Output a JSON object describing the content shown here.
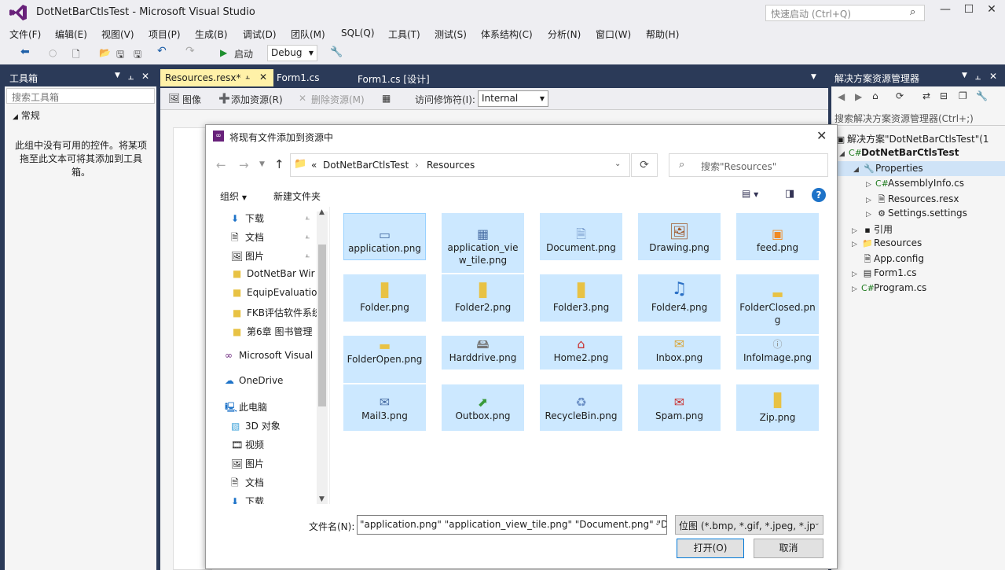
{
  "window": {
    "title": "DotNetBarCtlsTest - Microsoft Visual Studio",
    "quick_launch_placeholder": "快速启动 (Ctrl+Q)"
  },
  "menu": [
    "文件(F)",
    "编辑(E)",
    "视图(V)",
    "项目(P)",
    "生成(B)",
    "调试(D)",
    "团队(M)",
    "SQL(Q)",
    "工具(T)",
    "测试(S)",
    "体系结构(C)",
    "分析(N)",
    "窗口(W)",
    "帮助(H)"
  ],
  "toolbar": {
    "start_label": "启动",
    "config": "Debug"
  },
  "toolbox": {
    "title": "工具箱",
    "search_placeholder": "搜索工具箱",
    "group": "常规",
    "empty_text": "此组中没有可用的控件。将某项拖至此文本可将其添加到工具箱。"
  },
  "editor": {
    "tabs": [
      {
        "label": "Resources.resx*"
      },
      {
        "label": "Form1.cs"
      },
      {
        "label": "Form1.cs [设计]"
      }
    ],
    "tools": {
      "image": "图像",
      "add_resource": "添加资源(R)",
      "remove_resource": "删除资源(M)",
      "access_label": "访问修饰符(I):",
      "access_value": "Internal"
    }
  },
  "solution_explorer": {
    "title": "解决方案资源管理器",
    "search_placeholder": "搜索解决方案资源管理器(Ctrl+;)",
    "items": [
      {
        "label": "解决方案\"DotNetBarCtlsTest\"(1",
        "icon": "solution-icon"
      },
      {
        "label": "DotNetBarCtlsTest",
        "icon": "csharp-project-icon"
      },
      {
        "label": "Properties",
        "icon": "wrench-icon"
      },
      {
        "label": "AssemblyInfo.cs",
        "icon": "csharp-file-icon"
      },
      {
        "label": "Resources.resx",
        "icon": "resx-icon"
      },
      {
        "label": "Settings.settings",
        "icon": "gear-icon"
      },
      {
        "label": "引用",
        "icon": "references-icon"
      },
      {
        "label": "Resources",
        "icon": "folder-icon"
      },
      {
        "label": "App.config",
        "icon": "config-icon"
      },
      {
        "label": "Form1.cs",
        "icon": "form-icon"
      },
      {
        "label": "Program.cs",
        "icon": "csharp-file-icon"
      }
    ]
  },
  "dialog": {
    "title": "将现有文件添加到资源中",
    "breadcrumb": [
      "«",
      "DotNetBarCtlsTest",
      "Resources"
    ],
    "search_placeholder": "搜索\"Resources\"",
    "organize": "组织",
    "new_folder": "新建文件夹",
    "nav": [
      {
        "label": "下载",
        "icon": "download-icon",
        "pinned": true
      },
      {
        "label": "文档",
        "icon": "document-icon",
        "pinned": true
      },
      {
        "label": "图片",
        "icon": "pictures-icon",
        "pinned": true
      },
      {
        "label": "DotNetBar Wir",
        "icon": "folder-icon",
        "pinned": false
      },
      {
        "label": "EquipEvaluatio",
        "icon": "folder-icon",
        "pinned": false
      },
      {
        "label": "FKB评估软件系统",
        "icon": "folder-icon",
        "pinned": false
      },
      {
        "label": "第6章 图书管理",
        "icon": "folder-icon",
        "pinned": false
      },
      {
        "label": "Microsoft Visual",
        "icon": "vs-icon",
        "pinned": false
      },
      {
        "label": "OneDrive",
        "icon": "cloud-icon",
        "pinned": false
      },
      {
        "label": "此电脑",
        "icon": "computer-icon",
        "pinned": false
      },
      {
        "label": "3D 对象",
        "icon": "cube-icon",
        "pinned": false
      },
      {
        "label": "视频",
        "icon": "video-icon",
        "pinned": false
      },
      {
        "label": "图片",
        "icon": "pictures-icon",
        "pinned": false
      },
      {
        "label": "文档",
        "icon": "document-icon",
        "pinned": false
      },
      {
        "label": "下载",
        "icon": "download-icon",
        "pinned": false
      }
    ],
    "files": [
      {
        "name": "application.png",
        "icon": "window-icon"
      },
      {
        "name": "application_view_tile.png",
        "icon": "tile-icon"
      },
      {
        "name": "Document.png",
        "icon": "document-icon"
      },
      {
        "name": "Drawing.png",
        "icon": "drawing-icon"
      },
      {
        "name": "feed.png",
        "icon": "rss-icon"
      },
      {
        "name": "Folder.png",
        "icon": "folder-icon"
      },
      {
        "name": "Folder2.png",
        "icon": "folder-icon"
      },
      {
        "name": "Folder3.png",
        "icon": "folder-icon"
      },
      {
        "name": "Folder4.png",
        "icon": "music-folder-icon"
      },
      {
        "name": "FolderClosed.png",
        "icon": "folder-icon"
      },
      {
        "name": "FolderOpen.png",
        "icon": "folder-open-icon"
      },
      {
        "name": "Harddrive.png",
        "icon": "harddrive-icon"
      },
      {
        "name": "Home2.png",
        "icon": "home-icon"
      },
      {
        "name": "Inbox.png",
        "icon": "inbox-icon"
      },
      {
        "name": "InfoImage.png",
        "icon": "info-icon"
      },
      {
        "name": "Mail3.png",
        "icon": "mail-icon"
      },
      {
        "name": "Outbox.png",
        "icon": "outbox-icon"
      },
      {
        "name": "RecycleBin.png",
        "icon": "recycle-icon"
      },
      {
        "name": "Spam.png",
        "icon": "spam-icon"
      },
      {
        "name": "Zip.png",
        "icon": "zip-folder-icon"
      }
    ],
    "filename_label": "文件名(N):",
    "filename_value": "\"application.png\" \"application_view_tile.png\" \"Document.png\" \"D",
    "filter": "位图 (*.bmp, *.gif, *.jpeg, *.jp",
    "open": "打开(O)",
    "cancel": "取消"
  }
}
